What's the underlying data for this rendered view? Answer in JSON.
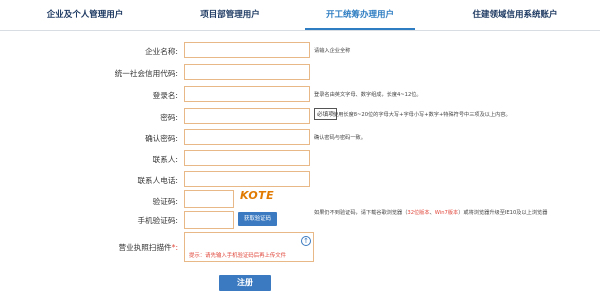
{
  "tabs": [
    {
      "label": "企业及个人管理用户"
    },
    {
      "label": "项目部管理用户"
    },
    {
      "label": "开工统筹办理用户"
    },
    {
      "label": "住建领域信用系统账户"
    }
  ],
  "form": {
    "company_name": {
      "label": "企业名称:",
      "value": "",
      "hint": "请输入企业全称"
    },
    "credit_code": {
      "label": "统一社会信用代码:",
      "value": ""
    },
    "login_name": {
      "label": "登录名:",
      "value": "",
      "hint": "登录名由英文字母、数字组成，长度4~12位。"
    },
    "password": {
      "label": "密码:",
      "value": "",
      "hint": "使用长度8~20位的字母大写+字母小写+数字+特殊符号中三项及以上内容。",
      "tooltip": "必填项"
    },
    "confirm_password": {
      "label": "确认密码:",
      "value": "",
      "hint": "确认密码与密码一致。"
    },
    "contact": {
      "label": "联系人:",
      "value": ""
    },
    "contact_phone": {
      "label": "联系人电话:",
      "value": ""
    },
    "captcha": {
      "label": "验证码:",
      "value": "",
      "code": "KOTE"
    },
    "sms_code": {
      "label": "手机验证码:",
      "value": "",
      "button": "获取验证码",
      "hint_parts": [
        "如果仍不到验证码，请下载谷歌浏览器（",
        "32位版本",
        "、",
        "Win7版本",
        "）或将浏览器升级至IE10及以上浏览器"
      ]
    },
    "business_license": {
      "label_prefix": "营业执照扫描件",
      "label_required": "*:",
      "tip": "提示：请先输入手机验证码后再上传文件",
      "upload_icon": "upload-icon"
    },
    "submit_label": "注册"
  }
}
